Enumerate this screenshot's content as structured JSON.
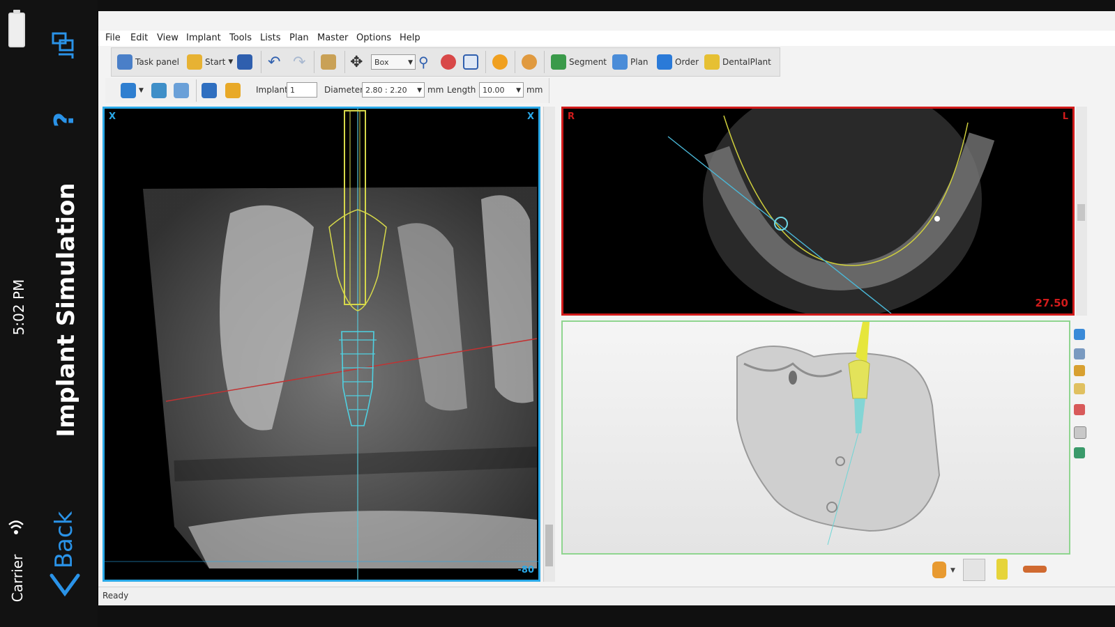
{
  "phone": {
    "time": "5:02 PM",
    "title": "Implant Simulation",
    "carrier": "Carrier",
    "back_label": "Back",
    "help_glyph": "?"
  },
  "menu": [
    "File",
    "Edit",
    "View",
    "Implant",
    "Tools",
    "Lists",
    "Plan",
    "Master",
    "Options",
    "Help"
  ],
  "toolbar": {
    "task_panel": "Task panel",
    "start": "Start",
    "zoom_select": "Box",
    "segment": "Segment",
    "plan": "Plan",
    "order": "Order",
    "dentalplant": "DentalPlant"
  },
  "implant_bar": {
    "implant_label": "Implant",
    "implant_value": "1",
    "diameter_label": "Diameter",
    "diameter_value": "2.80 : 2.20",
    "diameter_unit": "mm",
    "length_label": "Length",
    "length_value": "10.00",
    "length_unit": "mm"
  },
  "views": {
    "sagittal": {
      "corner_tl": "X",
      "corner_tr": "X",
      "value": "-80"
    },
    "axial": {
      "corner_tl": "R",
      "corner_tr": "L",
      "value": "27.50"
    }
  },
  "status": "Ready",
  "colors": {
    "sagittal_border": "#2aa9e8",
    "axial_border": "#d11b1b",
    "view3d_border": "#8fd58f",
    "ios_accent": "#2a93e8"
  }
}
